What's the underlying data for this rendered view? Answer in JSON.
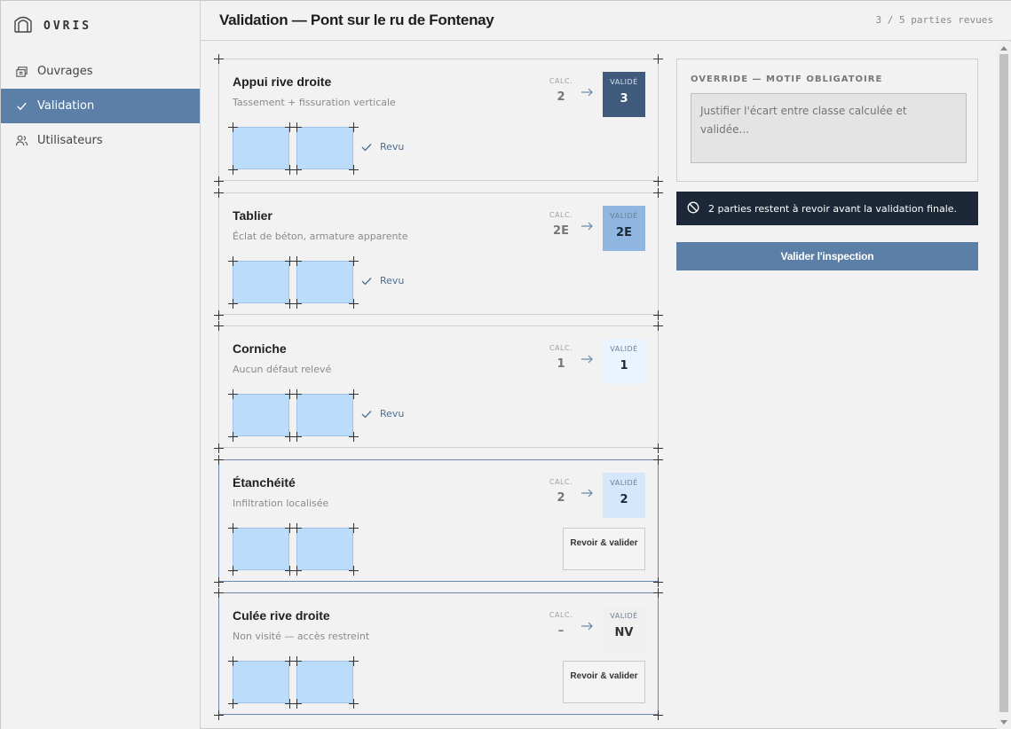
{
  "brand": {
    "name": "OVRIS"
  },
  "nav": [
    {
      "label": "Ouvrages",
      "icon": "bridge-icon"
    },
    {
      "label": "Validation",
      "icon": "check-icon",
      "active": true
    },
    {
      "label": "Utilisateurs",
      "icon": "users-icon"
    }
  ],
  "header": {
    "title": "Validation — Pont sur le ru de Fontenay",
    "progress": "3 / 5 parties revues"
  },
  "labels": {
    "calc": "CALC.",
    "valid": "VALIDÉ",
    "reviewed": "Revu",
    "review_button": "Revoir & valider"
  },
  "parts": [
    {
      "title": "Appui rive droite",
      "subtitle": "Tassement + fissuration verticale",
      "calc": "2",
      "valid": "3",
      "status": "reviewed",
      "valid_bg": "#3f5a7a",
      "valid_fg": "#ffffff"
    },
    {
      "title": "Tablier",
      "subtitle": "Éclat de béton, armature apparente",
      "calc": "2E",
      "valid": "2E",
      "status": "reviewed",
      "valid_bg": "#8fb6e0",
      "valid_fg": "#1c2838"
    },
    {
      "title": "Corniche",
      "subtitle": "Aucun défaut relevé",
      "calc": "1",
      "valid": "1",
      "status": "reviewed",
      "valid_bg": "#eaf4fe",
      "valid_fg": "#1c2838"
    },
    {
      "title": "Étanchéité",
      "subtitle": "Infiltration localisée",
      "calc": "2",
      "valid": "2",
      "status": "pending",
      "valid_bg": "#d5e8fb",
      "valid_fg": "#1c2838"
    },
    {
      "title": "Culée rive droite",
      "subtitle": "Non visité — accès restreint",
      "calc": "–",
      "valid": "NV",
      "status": "pending",
      "valid_bg": "#f0f0f0",
      "valid_fg": "#333333"
    }
  ],
  "override": {
    "label": "OVERRIDE — MOTIF OBLIGATOIRE",
    "placeholder": "Justifier l'écart entre classe calculée et validée..."
  },
  "notice": {
    "text": "2 parties restent à revoir avant la validation finale.",
    "icon": "blocked-icon"
  },
  "validate_button": "Valider l'inspection",
  "colors": {
    "accent": "#5b7fa6",
    "dark": "#1c2838",
    "thumb": "#bcdcfb"
  }
}
